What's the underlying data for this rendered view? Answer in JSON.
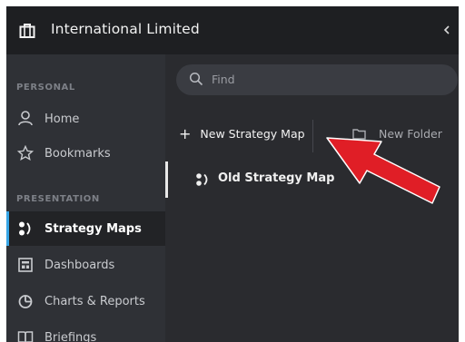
{
  "header": {
    "org_name": "International Limited",
    "org_icon": "briefcase-icon",
    "collapse_icon": "chevron-left-icon"
  },
  "sidebar": {
    "sections": [
      {
        "label": "PERSONAL"
      },
      {
        "label": "PRESENTATION"
      }
    ],
    "items": [
      {
        "label": "Home",
        "icon": "person-icon"
      },
      {
        "label": "Bookmarks",
        "icon": "star-icon"
      },
      {
        "label": "Strategy Maps",
        "icon": "strategy-map-icon",
        "active": true
      },
      {
        "label": "Dashboards",
        "icon": "dashboard-icon"
      },
      {
        "label": "Charts & Reports",
        "icon": "pie-chart-icon"
      },
      {
        "label": "Briefings",
        "icon": "book-icon"
      }
    ]
  },
  "main": {
    "search": {
      "placeholder": "Find"
    },
    "toolbar": {
      "new_strategy_map": "New Strategy Map",
      "new_folder": "New Folder"
    },
    "list": [
      {
        "label": "Old Strategy Map",
        "icon": "strategy-map-icon"
      }
    ]
  },
  "annotation": {
    "arrow_color": "#e01e26"
  },
  "colors": {
    "accent": "#37a5e6",
    "topbar": "#1e1f22",
    "sidebar": "#2f3136"
  }
}
